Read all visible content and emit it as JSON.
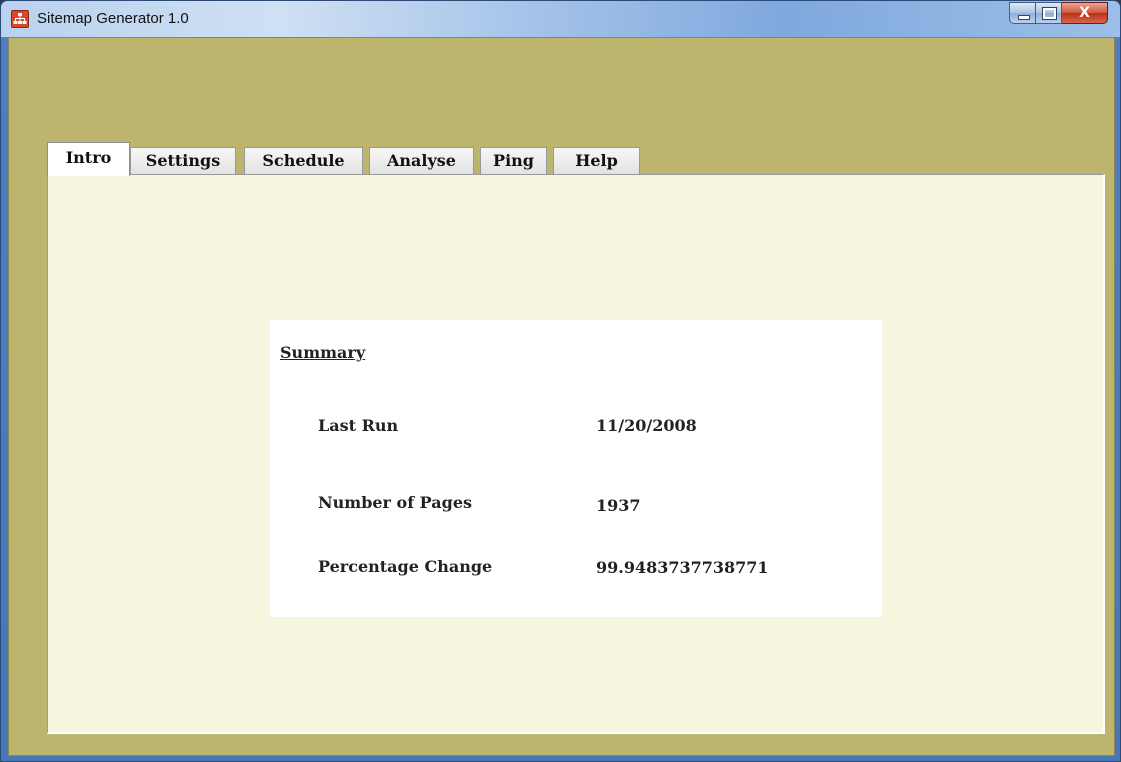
{
  "window": {
    "title": "Sitemap Generator 1.0",
    "close_glyph": "X"
  },
  "tabs": [
    {
      "label": "Intro",
      "active": true
    },
    {
      "label": "Settings",
      "active": false
    },
    {
      "label": "Schedule",
      "active": false
    },
    {
      "label": "Analyse",
      "active": false
    },
    {
      "label": "Ping",
      "active": false
    },
    {
      "label": "Help",
      "active": false
    }
  ],
  "summary": {
    "title": "Summary",
    "rows": [
      {
        "label": "Last Run",
        "value": "11/20/2008"
      },
      {
        "label": "Number of Pages",
        "value": "1937"
      },
      {
        "label": "Percentage Change",
        "value": "99.9483737738771"
      }
    ]
  },
  "colors": {
    "client_background": "#bdb56e",
    "panel_background": "#f5f5e0"
  },
  "icons": {
    "app": "sitemap-icon",
    "minimize": "minimize-icon",
    "maximize": "maximize-icon",
    "close": "close-icon"
  }
}
